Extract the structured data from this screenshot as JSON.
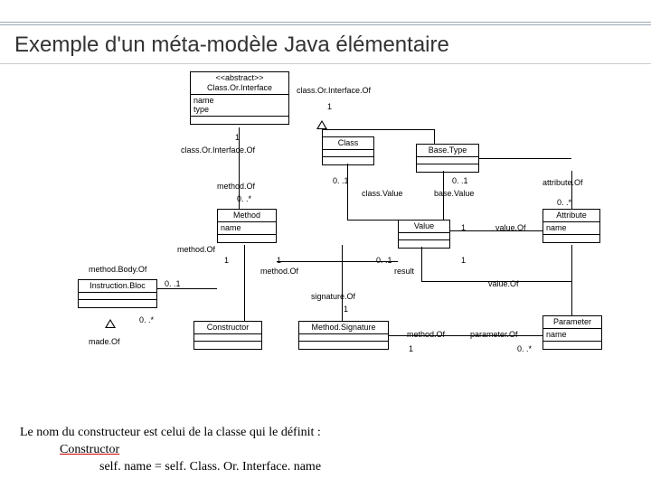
{
  "title": "Exemple d'un méta-modèle Java élémentaire",
  "classes": {
    "classOrInterface": {
      "stereotype": "<<abstract>>",
      "name": "Class.Or.Interface",
      "attrs": "name\ntype"
    },
    "class": {
      "name": "Class"
    },
    "baseType": {
      "name": "Base.Type"
    },
    "method": {
      "name": "Method",
      "attrs": "name"
    },
    "value": {
      "name": "Value"
    },
    "attribute": {
      "name": "Attribute",
      "attrs": "name"
    },
    "instructionBloc": {
      "name": "Instruction.Bloc"
    },
    "constructor": {
      "name": "Constructor"
    },
    "methodSignature": {
      "name": "Method.Signature"
    },
    "parameter": {
      "name": "Parameter",
      "attrs": "name"
    }
  },
  "labels": {
    "classOrInterfaceOf1": "class.Or.Interface.Of",
    "classOrInterfaceOf2": "class.Or.Interface.Of",
    "one_a": "1",
    "one_b": "1",
    "methodOf": "method.Of",
    "methodOf2": "method.Of",
    "methodOf3": "method.Of",
    "methodOf4": "method.Of",
    "zeroStar": "0. .*",
    "zeroStar2": "0. .*",
    "zeroStar3": "0. .*",
    "zeroOne": "0. .1",
    "zeroOne2": "0. .1",
    "zeroOne3": "0. .1",
    "zeroOne4": "0. .1",
    "classValue": "class.Value",
    "baseValue": "base.Value",
    "attributeOf": "attribute.Of",
    "valueOf": "value.Of",
    "valueOf2": "value.Of",
    "methodBodyOf": "method.Body.Of",
    "signatureOf": "signature.Of",
    "result": "result",
    "one_c": "1",
    "one_d": "1",
    "one_e": "1",
    "one_f": "1",
    "one_g": "1",
    "madeOf": "made.Of",
    "parameterOf": "parameter.Of"
  },
  "footer": {
    "line1": "Le nom du constructeur est celui de la classe qui le définit :",
    "line2": "Constructor",
    "line3": "self. name = self. Class. Or. Interface. name"
  }
}
